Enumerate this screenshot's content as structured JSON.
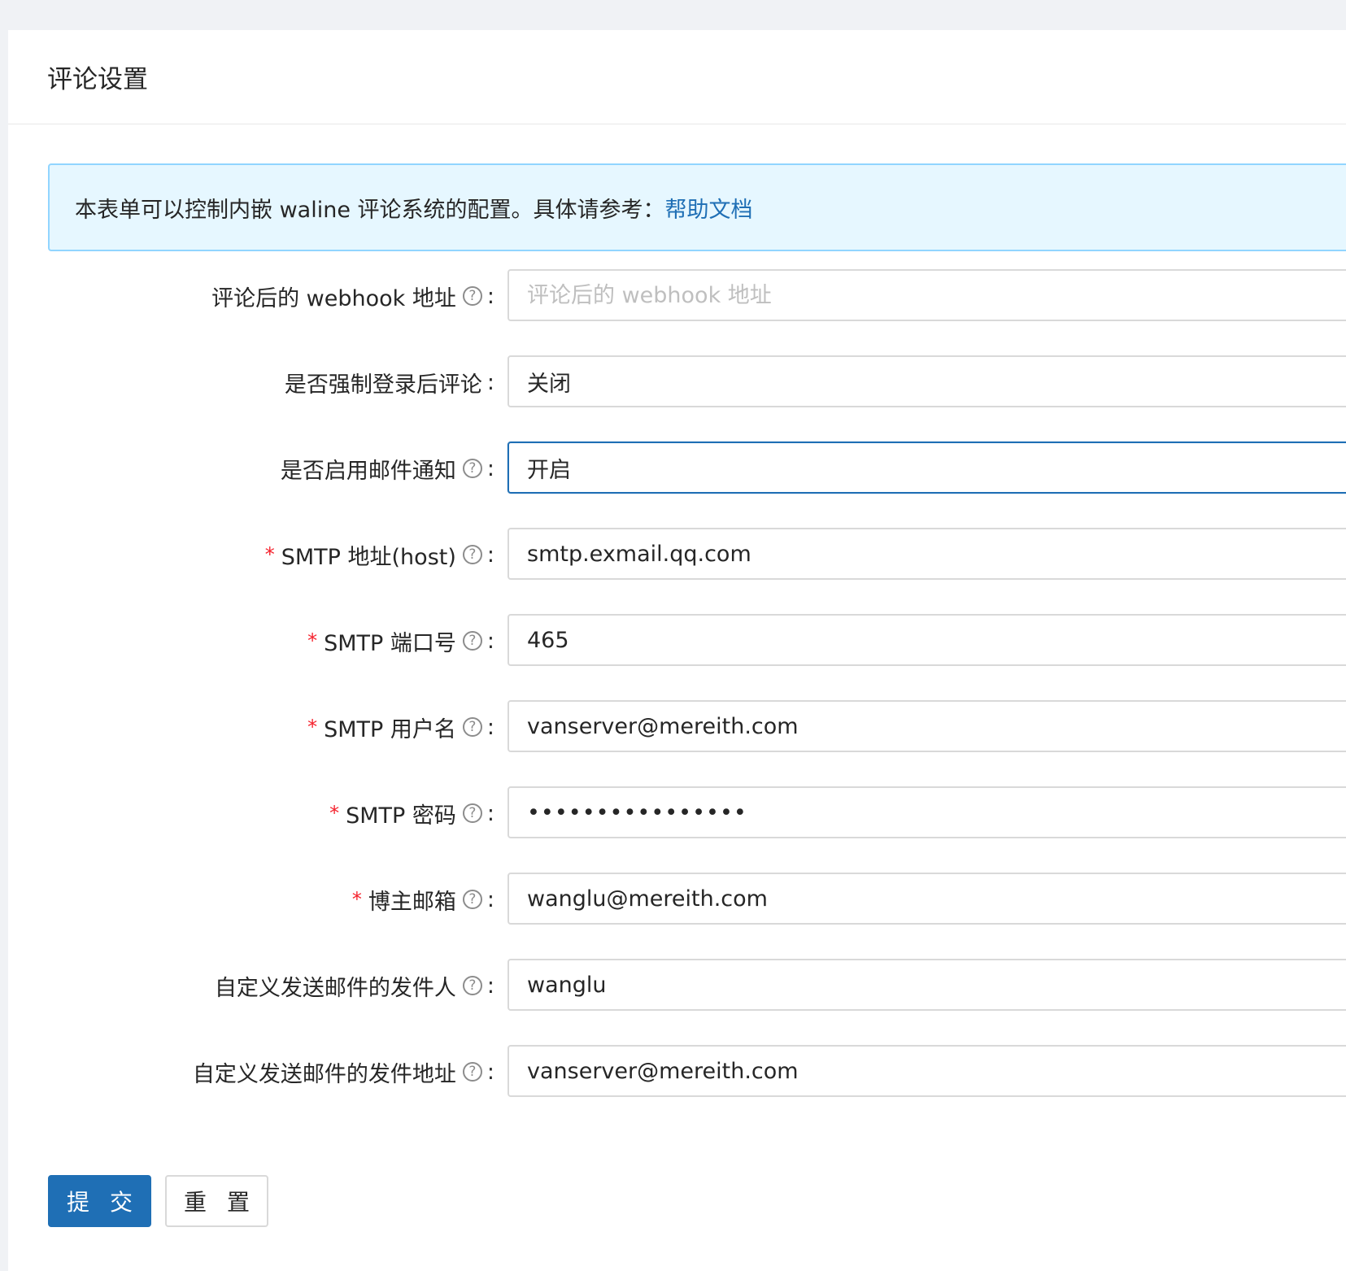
{
  "panel": {
    "title": "评论设置"
  },
  "alert": {
    "text": "本表单可以控制内嵌 waline 评论系统的配置。具体请参考：",
    "link_text": "帮助文档"
  },
  "form": {
    "fields": [
      {
        "label": "评论后的 webhook 地址",
        "required": false,
        "help": true,
        "type": "input",
        "value": "",
        "placeholder": "评论后的 webhook 地址"
      },
      {
        "label": "是否强制登录后评论",
        "required": false,
        "help": false,
        "type": "select",
        "value": "关闭",
        "placeholder": ""
      },
      {
        "label": "是否启用邮件通知",
        "required": false,
        "help": true,
        "type": "select",
        "value": "开启",
        "placeholder": ""
      },
      {
        "label": "SMTP 地址(host)",
        "required": true,
        "help": true,
        "type": "input",
        "value": "smtp.exmail.qq.com",
        "placeholder": ""
      },
      {
        "label": "SMTP 端口号",
        "required": true,
        "help": true,
        "type": "input",
        "value": "465",
        "placeholder": ""
      },
      {
        "label": "SMTP 用户名",
        "required": true,
        "help": true,
        "type": "input",
        "value": "vanserver@mereith.com",
        "placeholder": ""
      },
      {
        "label": "SMTP 密码",
        "required": true,
        "help": true,
        "type": "password",
        "value": "••••••••••••••••",
        "placeholder": ""
      },
      {
        "label": "博主邮箱",
        "required": true,
        "help": true,
        "type": "input",
        "value": "wanglu@mereith.com",
        "placeholder": ""
      },
      {
        "label": "自定义发送邮件的发件人",
        "required": false,
        "help": true,
        "type": "input",
        "value": "wanglu",
        "placeholder": ""
      },
      {
        "label": "自定义发送邮件的发件地址",
        "required": false,
        "help": true,
        "type": "input",
        "value": "vanserver@mereith.com",
        "placeholder": ""
      }
    ],
    "required_mark": "*",
    "help_glyph": "?",
    "colon": ":"
  },
  "buttons": {
    "submit_label": "提 交",
    "reset_label": "重 置"
  },
  "colors": {
    "primary": "#1f6fb5",
    "required": "#f5222d",
    "alert_bg": "#e6f7ff",
    "alert_border": "#91d5ff"
  }
}
